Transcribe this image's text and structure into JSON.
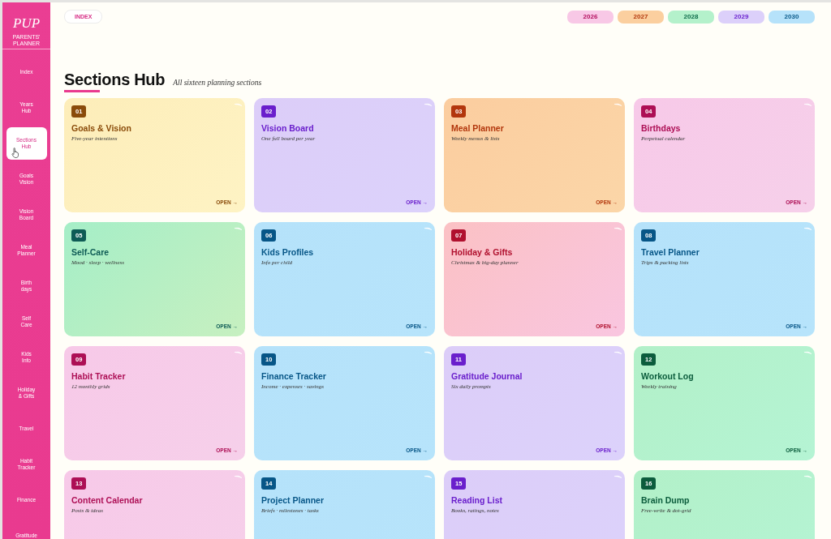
{
  "sidebar": {
    "logo": "PUP",
    "tagline": "PARENTS' PLANNER",
    "items": [
      {
        "label": "Index",
        "selected": false
      },
      {
        "label": "Years\nHub",
        "selected": false
      },
      {
        "label": "Sections\nHub",
        "selected": true
      },
      {
        "label": "Goals\nVision",
        "selected": false
      },
      {
        "label": "Vision\nBoard",
        "selected": false
      },
      {
        "label": "Meal\nPlanner",
        "selected": false
      },
      {
        "label": "Birth\ndays",
        "selected": false
      },
      {
        "label": "Self\nCare",
        "selected": false
      },
      {
        "label": "Kids\nInfo",
        "selected": false
      },
      {
        "label": "Holiday\n& Gifts",
        "selected": false
      },
      {
        "label": "Travel",
        "selected": false
      },
      {
        "label": "Habit\nTracker",
        "selected": false
      },
      {
        "label": "Finance",
        "selected": false
      },
      {
        "label": "Gratitude",
        "selected": false
      }
    ]
  },
  "topbar": {
    "index_button": "INDEX",
    "years": [
      {
        "label": "2026",
        "kind": "pink"
      },
      {
        "label": "2027",
        "kind": "orange"
      },
      {
        "label": "2028",
        "kind": "green"
      },
      {
        "label": "2029",
        "kind": "purple"
      },
      {
        "label": "2030",
        "kind": "blue"
      }
    ]
  },
  "header": {
    "title": "Sections Hub",
    "subtitle": "All sixteen planning sections"
  },
  "sections": [
    {
      "number": "01",
      "title": "Goals & Vision",
      "subtitle": "Five-year intentions",
      "action": "OPEN →",
      "kind": "yellow"
    },
    {
      "number": "02",
      "title": "Vision Board",
      "subtitle": "One full board per year",
      "action": "OPEN →",
      "kind": "purple"
    },
    {
      "number": "03",
      "title": "Meal Planner",
      "subtitle": "Weekly menus & lists",
      "action": "OPEN →",
      "kind": "orange"
    },
    {
      "number": "04",
      "title": "Birthdays",
      "subtitle": "Perpetual calendar",
      "action": "OPEN →",
      "kind": "pink"
    },
    {
      "number": "05",
      "title": "Self-Care",
      "subtitle": "Mood · sleep · wellness",
      "action": "OPEN →",
      "kind": "teal"
    },
    {
      "number": "06",
      "title": "Kids Profiles",
      "subtitle": "Info per child",
      "action": "OPEN →",
      "kind": "blue"
    },
    {
      "number": "07",
      "title": "Holiday & Gifts",
      "subtitle": "Christmas & big-day planner",
      "action": "OPEN →",
      "kind": "red"
    },
    {
      "number": "08",
      "title": "Travel Planner",
      "subtitle": "Trips & packing lists",
      "action": "OPEN →",
      "kind": "blue"
    },
    {
      "number": "09",
      "title": "Habit Tracker",
      "subtitle": "12 monthly grids",
      "action": "OPEN →",
      "kind": "pink"
    },
    {
      "number": "10",
      "title": "Finance Tracker",
      "subtitle": "Income · expenses · savings",
      "action": "OPEN →",
      "kind": "blue"
    },
    {
      "number": "11",
      "title": "Gratitude Journal",
      "subtitle": "Six daily prompts",
      "action": "OPEN →",
      "kind": "purple"
    },
    {
      "number": "12",
      "title": "Workout Log",
      "subtitle": "Weekly training",
      "action": "OPEN →",
      "kind": "green"
    },
    {
      "number": "13",
      "title": "Content Calendar",
      "subtitle": "Posts & ideas",
      "kind": "pink"
    },
    {
      "number": "14",
      "title": "Project Planner",
      "subtitle": "Briefs · milestones · tasks",
      "kind": "blue"
    },
    {
      "number": "15",
      "title": "Reading List",
      "subtitle": "Books, ratings, notes",
      "kind": "purple"
    },
    {
      "number": "16",
      "title": "Brain Dump",
      "subtitle": "Free-write & dot-grid",
      "kind": "green"
    }
  ]
}
